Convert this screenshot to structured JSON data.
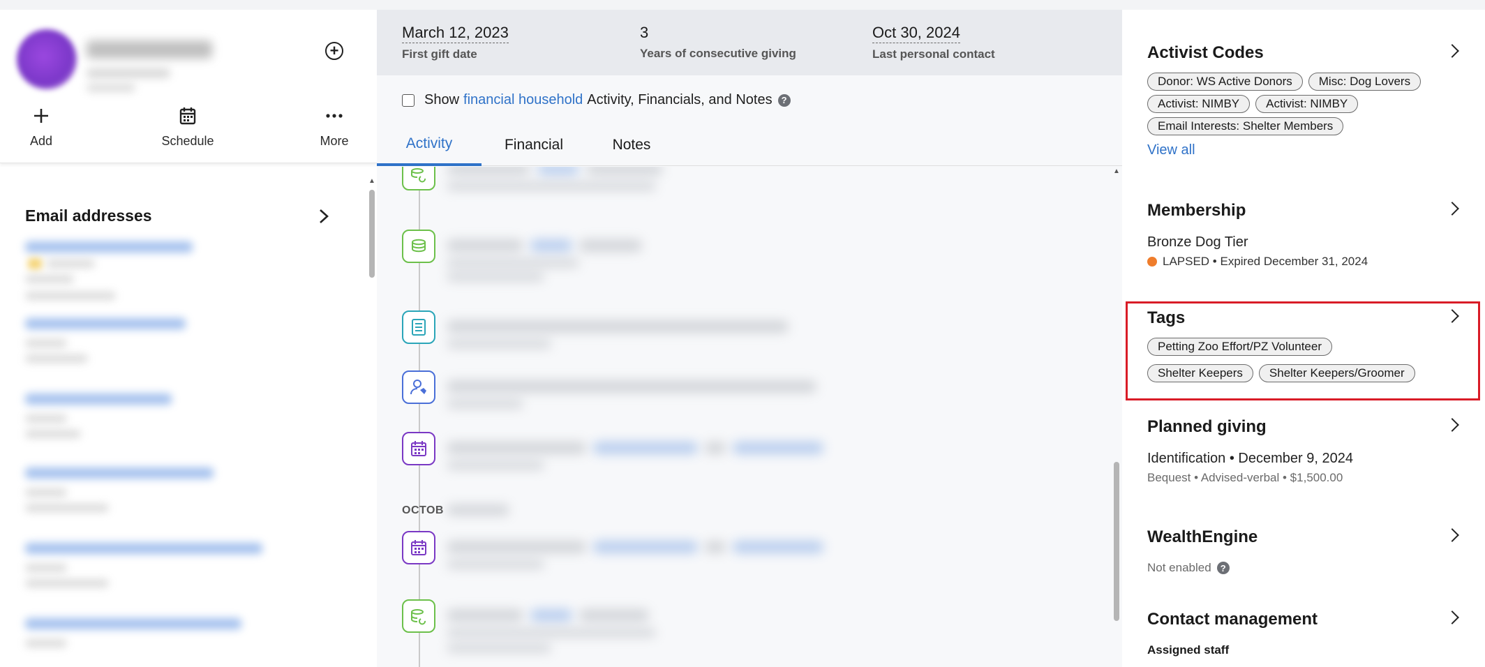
{
  "stats": {
    "first_gift": {
      "value": "March 12, 2023",
      "caption": "First gift date"
    },
    "years": {
      "value": "3",
      "caption": "Years of consecutive giving"
    },
    "last_contact": {
      "value": "Oct 30, 2024",
      "caption": "Last personal contact"
    }
  },
  "household": {
    "prefix": "Show",
    "link": "financial household",
    "suffix": "Activity, Financials, and Notes",
    "help_icon": "?"
  },
  "tabs": [
    {
      "label": "Activity",
      "active": true
    },
    {
      "label": "Financial",
      "active": false
    },
    {
      "label": "Notes",
      "active": false
    }
  ],
  "actions": [
    {
      "label": "Add",
      "icon": "plus-icon"
    },
    {
      "label": "Schedule",
      "icon": "calendar-icon"
    },
    {
      "label": "More",
      "icon": "more-icon"
    }
  ],
  "left": {
    "email_title": "Email addresses"
  },
  "timeline": {
    "month_label": "OCTOB"
  },
  "right": {
    "activist_codes": {
      "title": "Activist Codes",
      "tags": [
        "Donor: WS Active Donors",
        "Misc: Dog Lovers",
        "Activist: NIMBY",
        "Activist: NIMBY",
        "Email Interests: Shelter Members"
      ],
      "view_all": "View all"
    },
    "membership": {
      "title": "Membership",
      "tier": "Bronze Dog Tier",
      "status": "LAPSED • Expired December 31, 2024",
      "status_color": "#ef7d2c"
    },
    "tags": {
      "title": "Tags",
      "items": [
        "Petting Zoo Effort/PZ Volunteer",
        "Shelter Keepers",
        "Shelter Keepers/Groomer"
      ]
    },
    "planned_giving": {
      "title": "Planned giving",
      "main": "Identification • December 9, 2024",
      "detail": "Bequest • Advised-verbal • $1,500.00"
    },
    "wealthengine": {
      "title": "WealthEngine",
      "status": "Not enabled"
    },
    "contact_management": {
      "title": "Contact management",
      "sub": "Assigned staff"
    }
  },
  "colors": {
    "accent": "#2f72c8",
    "highlight": "#d91c27"
  }
}
